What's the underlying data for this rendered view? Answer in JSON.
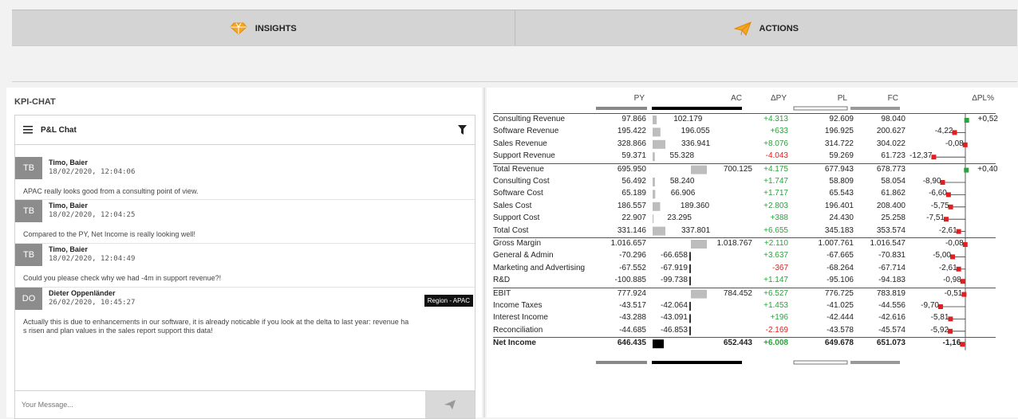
{
  "tabs": [
    {
      "label": "INSIGHTS",
      "icon": "diamond-icon"
    },
    {
      "label": "ACTIONS",
      "icon": "paper-plane-icon"
    }
  ],
  "kpi_chat": {
    "title": "KPI-CHAT",
    "chat_title": "P&L Chat",
    "messages": [
      {
        "initials": "TB",
        "name": "Timo, Baier",
        "time": "18/02/2020, 12:04:06",
        "text": "APAC really looks good from a consulting point of view."
      },
      {
        "initials": "TB",
        "name": "Timo, Baier",
        "time": "18/02/2020, 12:04:25",
        "text": "Compared to the PY, Net Income is really looking well!"
      },
      {
        "initials": "TB",
        "name": "Timo, Baier",
        "time": "18/02/2020, 12:04:49",
        "text": "Could you please check why we had -4m in support revenue?!"
      },
      {
        "initials": "DO",
        "name": "Dieter Oppenländer",
        "time": "26/02/2020, 10:45:27",
        "badge": "Region - APAC",
        "text1": "Actually this is due to enhancements in our software, it is already noticable if you look at the delta to last year: revenue ha",
        "text2": "s risen and plan values in the sales report support this data!"
      }
    ],
    "input_placeholder": "Your Message..."
  },
  "table": {
    "headers": [
      "PY",
      "AC",
      "ΔPY",
      "PL",
      "FC",
      "ΔPL%"
    ],
    "rows": [
      {
        "name": "Consulting Revenue",
        "py": "97.866",
        "ac": "102.179",
        "dpy": "+4.313",
        "pl": "92.609",
        "fc": "98.040",
        "dpl": "+0,52",
        "dplv": 0.52
      },
      {
        "name": "Software Revenue",
        "py": "195.422",
        "ac": "196.055",
        "dpy": "+633",
        "pl": "196.925",
        "fc": "200.627",
        "dpl": "-4,22",
        "dplv": -4.22
      },
      {
        "name": "Sales Revenue",
        "py": "328.866",
        "ac": "336.941",
        "dpy": "+8.076",
        "pl": "314.722",
        "fc": "304.022",
        "dpl": "-0,08",
        "dplv": -0.08
      },
      {
        "name": "Support Revenue",
        "py": "59.371",
        "ac": "55.328",
        "dpy": "-4.043",
        "pl": "59.269",
        "fc": "61.723",
        "dpl": "-12,37",
        "dplv": -12.37
      },
      {
        "name": "Total Revenue",
        "py": "695.950",
        "ac": "700.125",
        "dpy": "+4.175",
        "pl": "677.943",
        "fc": "678.773",
        "dpl": "+0,40",
        "dplv": 0.4
      },
      {
        "name": "Consulting Cost",
        "py": "56.492",
        "ac": "58.240",
        "dpy": "+1.747",
        "pl": "58.809",
        "fc": "58.054",
        "dpl": "-8,90",
        "dplv": -8.9
      },
      {
        "name": "Software Cost",
        "py": "65.189",
        "ac": "66.906",
        "dpy": "+1.717",
        "pl": "65.543",
        "fc": "61.862",
        "dpl": "-6,60",
        "dplv": -6.6
      },
      {
        "name": "Sales Cost",
        "py": "186.557",
        "ac": "189.360",
        "dpy": "+2.803",
        "pl": "196.401",
        "fc": "208.400",
        "dpl": "-5,75",
        "dplv": -5.75
      },
      {
        "name": "Support Cost",
        "py": "22.907",
        "ac": "23.295",
        "dpy": "+388",
        "pl": "24.430",
        "fc": "25.258",
        "dpl": "-7,51",
        "dplv": -7.51
      },
      {
        "name": "Total Cost",
        "py": "331.146",
        "ac": "337.801",
        "dpy": "+6.655",
        "pl": "345.183",
        "fc": "353.574",
        "dpl": "-2,61",
        "dplv": -2.61
      },
      {
        "name": "Gross Margin",
        "py": "1.016.657",
        "ac": "1.018.767",
        "dpy": "+2.110",
        "pl": "1.007.761",
        "fc": "1.016.547",
        "dpl": "-0,08",
        "dplv": -0.08
      },
      {
        "name": "General & Admin",
        "py": "-70.296",
        "ac": "-66.658",
        "dpy": "+3.637",
        "pl": "-67.665",
        "fc": "-70.831",
        "dpl": "-5,00",
        "dplv": -5.0
      },
      {
        "name": "Marketing and Advertising",
        "py": "-67.552",
        "ac": "-67.919",
        "dpy": "-367",
        "pl": "-68.264",
        "fc": "-67.714",
        "dpl": "-2,61",
        "dplv": -2.61
      },
      {
        "name": "R&D",
        "py": "-100.885",
        "ac": "-99.738",
        "dpy": "+1.147",
        "pl": "-95.106",
        "fc": "-94.183",
        "dpl": "-0,98",
        "dplv": -0.98
      },
      {
        "name": "EBIT",
        "py": "777.924",
        "ac": "784.452",
        "dpy": "+6.527",
        "pl": "776.725",
        "fc": "783.819",
        "dpl": "-0,51",
        "dplv": -0.51
      },
      {
        "name": "Income Taxes",
        "py": "-43.517",
        "ac": "-42.064",
        "dpy": "+1.453",
        "pl": "-41.025",
        "fc": "-44.556",
        "dpl": "-9,70",
        "dplv": -9.7
      },
      {
        "name": "Interest Income",
        "py": "-43.288",
        "ac": "-43.091",
        "dpy": "+196",
        "pl": "-42.444",
        "fc": "-42.616",
        "dpl": "-5,81",
        "dplv": -5.81
      },
      {
        "name": "Reconciliation",
        "py": "-44.685",
        "ac": "-46.853",
        "dpy": "-2.169",
        "pl": "-43.578",
        "fc": "-45.574",
        "dpl": "-5,92",
        "dplv": -5.92
      },
      {
        "name": "Net Income",
        "py": "646.435",
        "ac": "652.443",
        "dpy": "+6.008",
        "pl": "649.678",
        "fc": "651.073",
        "dpl": "-1,16",
        "dplv": -1.16
      }
    ]
  },
  "colors": {
    "positive": "#2aa33a",
    "negative": "#e02020",
    "ac_bar": "#bdbdbd",
    "net_bar": "#000000"
  }
}
